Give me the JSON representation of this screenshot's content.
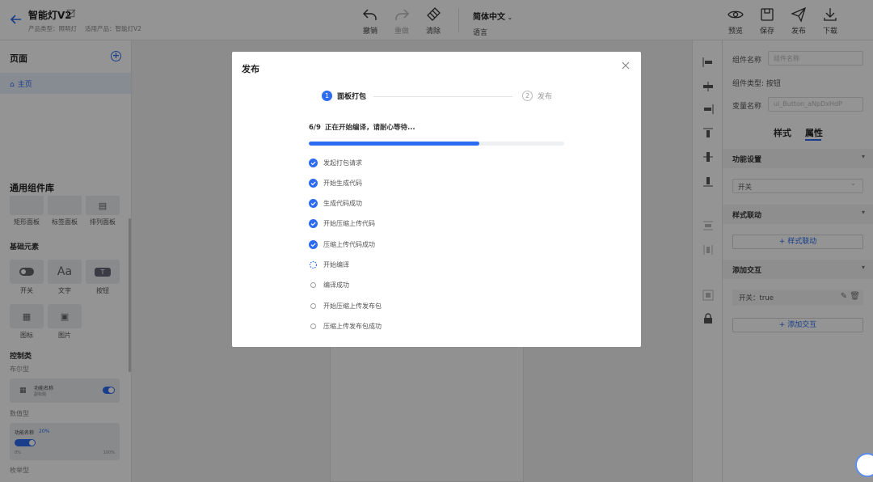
{
  "header": {
    "title": "智能灯V2",
    "product_type": "产品类型：照明灯",
    "applicable_product": "适用产品：智能灯V2",
    "tools": [
      {
        "label": "撤销",
        "icon": "undo-icon",
        "disabled": false
      },
      {
        "label": "重做",
        "icon": "redo-icon",
        "disabled": true
      },
      {
        "label": "清除",
        "icon": "clear-icon",
        "disabled": false
      }
    ],
    "language": {
      "value": "简体中文",
      "label": "语言"
    },
    "actions": [
      {
        "label": "预览",
        "icon": "eye-icon"
      },
      {
        "label": "保存",
        "icon": "save-icon"
      },
      {
        "label": "发布",
        "icon": "send-icon"
      },
      {
        "label": "下载",
        "icon": "download-icon"
      }
    ]
  },
  "left": {
    "pages_title": "页面",
    "pages": [
      {
        "label": "主页"
      }
    ],
    "library_title": "通用组件库",
    "panels": [
      "矩形面板",
      "标签面板",
      "排列面板"
    ],
    "basic_title": "基础元素",
    "basic": [
      "开关",
      "文字",
      "按钮",
      "图标",
      "图片"
    ],
    "text_glyph": "Aa",
    "button_glyph": "T",
    "control_title": "控制类",
    "layout_sub": "布尔型",
    "func_name": "功能名称",
    "func_desc": "副标题",
    "numeric_sub": "数值型",
    "numeric": {
      "name": "功能名称",
      "value": "20%",
      "min": "0%",
      "max": "100%",
      "fraction": 0.2
    },
    "enum_sub": "枚举型"
  },
  "right": {
    "component_name_label": "组件名称",
    "component_name_placeholder": "组件名称",
    "component_type_label": "组件类型:",
    "component_type_value": "按钮",
    "variable_name_label": "变量名称",
    "variable_name_value": "ui_Button_aNpDxHdP",
    "tabs": [
      "样式",
      "属性"
    ],
    "active_tab": "属性",
    "function_settings": "功能设置",
    "function_select": "开关",
    "style_link": "样式联动",
    "add_style_link": "+ 样式联动",
    "add_interaction": "添加交互",
    "interaction_item": "开关：true",
    "add_interaction_btn": "+ 添加交互"
  },
  "modal": {
    "title": "发布",
    "steps": [
      {
        "num": "1",
        "label": "面板打包",
        "state": "active"
      },
      {
        "num": "2",
        "label": "发布",
        "state": "pending"
      }
    ],
    "progress_count": "6/9",
    "progress_text": "正在开始编译，请耐心等待...",
    "progress_fraction": 0.667,
    "tasks": [
      {
        "label": "发起打包请求",
        "status": "done"
      },
      {
        "label": "开始生成代码",
        "status": "done"
      },
      {
        "label": "生成代码成功",
        "status": "done"
      },
      {
        "label": "开始压缩上传代码",
        "status": "done"
      },
      {
        "label": "压缩上传代码成功",
        "status": "done"
      },
      {
        "label": "开始编译",
        "status": "loading"
      },
      {
        "label": "编译成功",
        "status": "pending"
      },
      {
        "label": "开始压缩上传发布包",
        "status": "pending"
      },
      {
        "label": "压缩上传发布包成功",
        "status": "pending"
      }
    ]
  },
  "colors": {
    "accent": "#2d6bf0",
    "overlay": "rgba(0,0,0,0.42)"
  }
}
